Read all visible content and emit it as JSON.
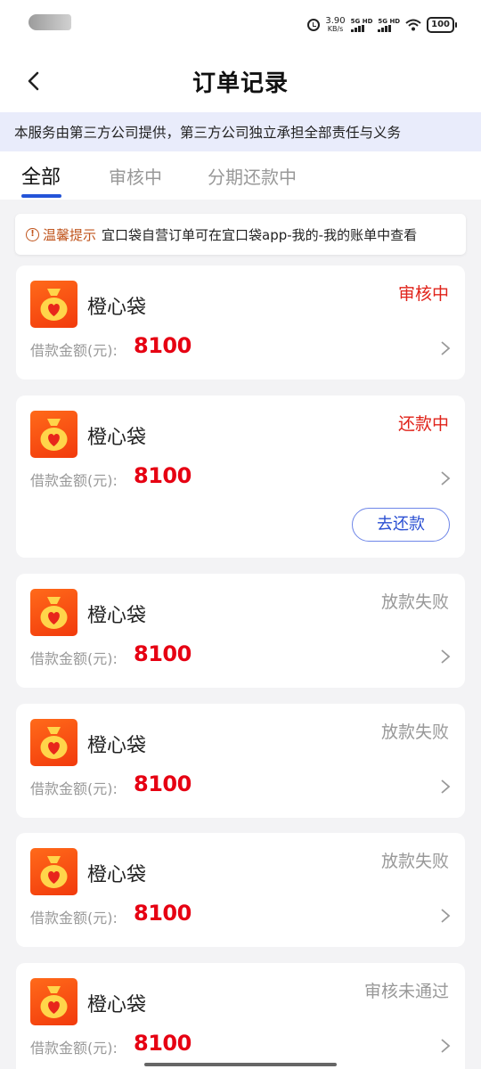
{
  "status_bar": {
    "speed_value": "3.90",
    "speed_unit": "KB/s",
    "sim1_label": "5G HD",
    "sim2_label": "5G HD",
    "battery": "100"
  },
  "nav": {
    "title": "订单记录"
  },
  "notice": {
    "text": "本服务由第三方公司提供，第三方公司独立承担全部责任与义务"
  },
  "tabs": [
    {
      "label": "全部",
      "active": true
    },
    {
      "label": "审核中",
      "active": false
    },
    {
      "label": "分期还款中",
      "active": false
    }
  ],
  "tip": {
    "label": "温馨提示",
    "text": "宜口袋自营订单可在宜口袋app-我的-我的账单中查看"
  },
  "orders": [
    {
      "name": "橙心袋",
      "status": "审核中",
      "status_color": "#e0231a",
      "amount_label": "借款金额(元):",
      "amount": "8100"
    },
    {
      "name": "橙心袋",
      "status": "还款中",
      "status_color": "#e0231a",
      "amount_label": "借款金额(元):",
      "amount": "8100",
      "action_label": "去还款"
    },
    {
      "name": "橙心袋",
      "status": "放款失败",
      "status_color": "#999999",
      "amount_label": "借款金额(元):",
      "amount": "8100"
    },
    {
      "name": "橙心袋",
      "status": "放款失败",
      "status_color": "#999999",
      "amount_label": "借款金额(元):",
      "amount": "8100"
    },
    {
      "name": "橙心袋",
      "status": "放款失败",
      "status_color": "#999999",
      "amount_label": "借款金额(元):",
      "amount": "8100"
    },
    {
      "name": "橙心袋",
      "status": "审核未通过",
      "status_color": "#999999",
      "amount_label": "借款金额(元):",
      "amount": "8100"
    }
  ],
  "colors": {
    "accent": "#2454d8",
    "brand_orange": "#ff6a1a",
    "amount_red": "#e60012"
  }
}
